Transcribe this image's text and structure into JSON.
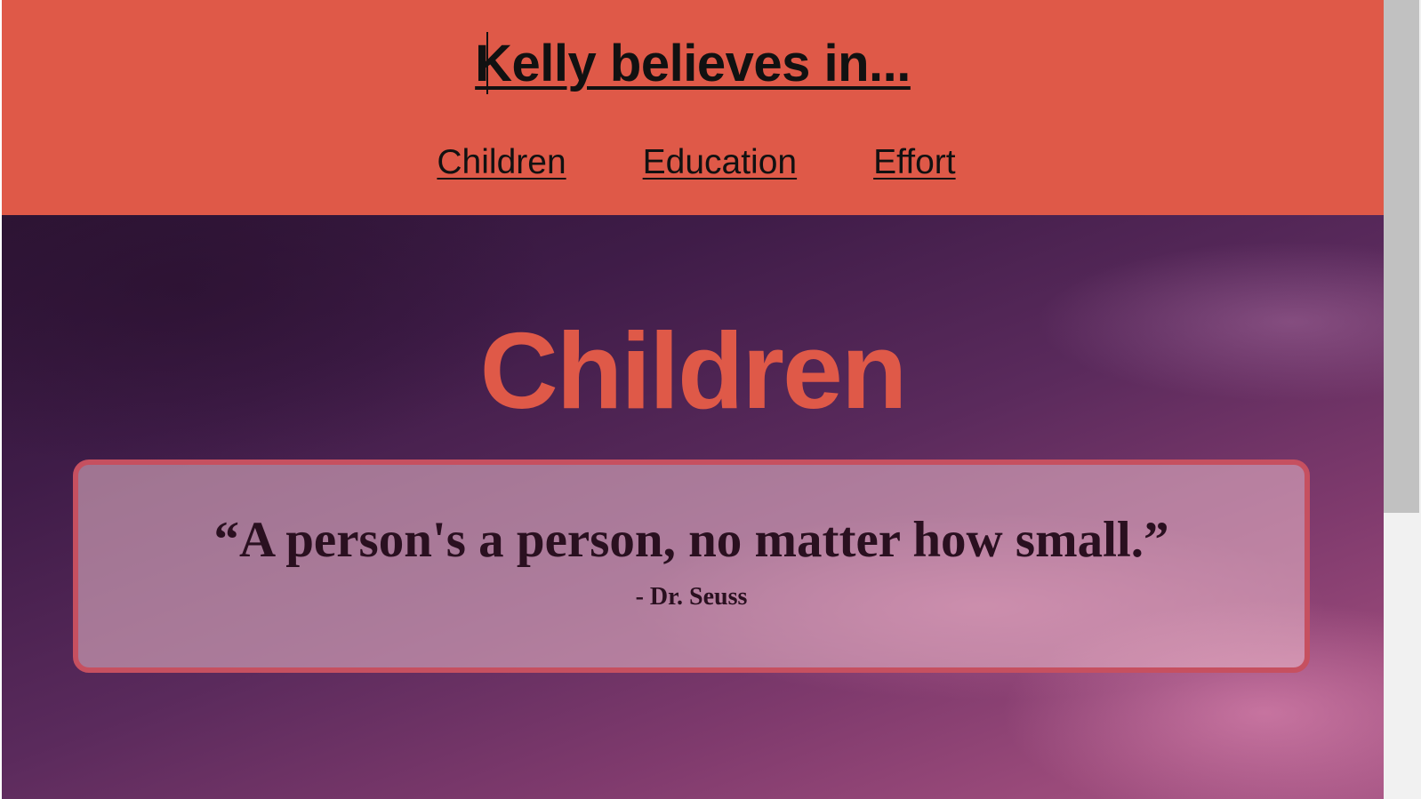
{
  "header": {
    "title": "Kelly believes in...",
    "nav": [
      {
        "label": "Children"
      },
      {
        "label": "Education"
      },
      {
        "label": "Effort"
      }
    ]
  },
  "hero": {
    "section_title": "Children",
    "quote": "“A person's a person, no matter how small.”",
    "author": "- Dr. Seuss"
  },
  "colors": {
    "header_background": "#df5948",
    "section_title": "#df5948",
    "quote_border": "#c65060",
    "text_dark": "#111111"
  }
}
